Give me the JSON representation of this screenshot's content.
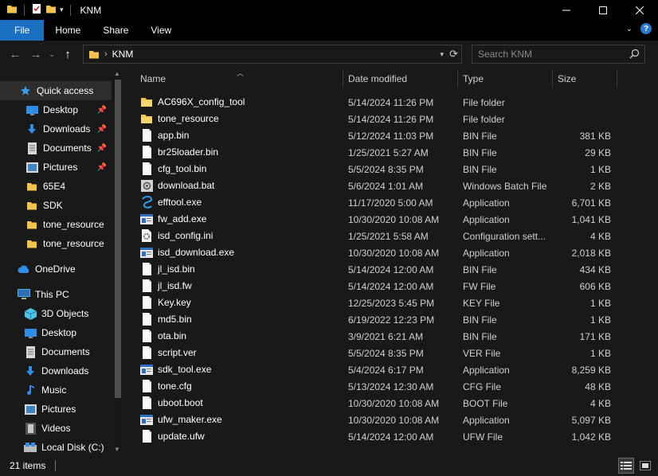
{
  "window": {
    "title": "KNM"
  },
  "ribbon": {
    "tabs": [
      "File",
      "Home",
      "Share",
      "View"
    ]
  },
  "address": {
    "crumbs": [
      "KNM"
    ]
  },
  "search": {
    "placeholder": "Search KNM"
  },
  "sidebar": {
    "items": [
      {
        "label": "Quick access",
        "icon": "star-icon"
      },
      {
        "label": "Desktop",
        "icon": "desktop-icon",
        "pinned": true
      },
      {
        "label": "Downloads",
        "icon": "download-icon",
        "pinned": true
      },
      {
        "label": "Documents",
        "icon": "documents-icon",
        "pinned": true
      },
      {
        "label": "Pictures",
        "icon": "pictures-icon",
        "pinned": true
      },
      {
        "label": "65E4",
        "icon": "folder-icon"
      },
      {
        "label": "SDK",
        "icon": "folder-icon"
      },
      {
        "label": "tone_resource",
        "icon": "folder-icon"
      },
      {
        "label": "tone_resource",
        "icon": "folder-icon"
      },
      {
        "label": "OneDrive",
        "icon": "cloud-icon"
      },
      {
        "label": "This PC",
        "icon": "pc-icon"
      },
      {
        "label": "3D Objects",
        "icon": "cube-icon"
      },
      {
        "label": "Desktop",
        "icon": "desktop-icon"
      },
      {
        "label": "Documents",
        "icon": "documents-icon"
      },
      {
        "label": "Downloads",
        "icon": "download-icon"
      },
      {
        "label": "Music",
        "icon": "music-icon"
      },
      {
        "label": "Pictures",
        "icon": "pictures-icon"
      },
      {
        "label": "Videos",
        "icon": "videos-icon"
      },
      {
        "label": "Local Disk (C:)",
        "icon": "disk-icon"
      }
    ]
  },
  "columns": {
    "name": "Name",
    "date": "Date modified",
    "type": "Type",
    "size": "Size"
  },
  "files": [
    {
      "name": "AC696X_config_tool",
      "date": "5/14/2024 11:26 PM",
      "type": "File folder",
      "size": "",
      "icon": "folder-icon"
    },
    {
      "name": "tone_resource",
      "date": "5/14/2024 11:26 PM",
      "type": "File folder",
      "size": "",
      "icon": "folder-icon"
    },
    {
      "name": "app.bin",
      "date": "5/12/2024 11:03 PM",
      "type": "BIN File",
      "size": "381 KB",
      "icon": "file-icon"
    },
    {
      "name": "br25loader.bin",
      "date": "1/25/2021 5:27 AM",
      "type": "BIN File",
      "size": "29 KB",
      "icon": "file-icon"
    },
    {
      "name": "cfg_tool.bin",
      "date": "5/5/2024 8:35 PM",
      "type": "BIN File",
      "size": "1 KB",
      "icon": "file-icon"
    },
    {
      "name": "download.bat",
      "date": "5/6/2024 1:01 AM",
      "type": "Windows Batch File",
      "size": "2 KB",
      "icon": "batch-icon"
    },
    {
      "name": "efftool.exe",
      "date": "11/17/2020 5:00 AM",
      "type": "Application",
      "size": "6,701 KB",
      "icon": "efftool-icon"
    },
    {
      "name": "fw_add.exe",
      "date": "10/30/2020 10:08 AM",
      "type": "Application",
      "size": "1,041 KB",
      "icon": "app-icon"
    },
    {
      "name": "isd_config.ini",
      "date": "1/25/2021 5:58 AM",
      "type": "Configuration sett...",
      "size": "4 KB",
      "icon": "config-icon"
    },
    {
      "name": "isd_download.exe",
      "date": "10/30/2020 10:08 AM",
      "type": "Application",
      "size": "2,018 KB",
      "icon": "app-icon"
    },
    {
      "name": "jl_isd.bin",
      "date": "5/14/2024 12:00 AM",
      "type": "BIN File",
      "size": "434 KB",
      "icon": "file-icon"
    },
    {
      "name": "jl_isd.fw",
      "date": "5/14/2024 12:00 AM",
      "type": "FW File",
      "size": "606 KB",
      "icon": "file-icon"
    },
    {
      "name": "Key.key",
      "date": "12/25/2023 5:45 PM",
      "type": "KEY File",
      "size": "1 KB",
      "icon": "file-icon"
    },
    {
      "name": "md5.bin",
      "date": "6/19/2022 12:23 PM",
      "type": "BIN File",
      "size": "1 KB",
      "icon": "file-icon"
    },
    {
      "name": "ota.bin",
      "date": "3/9/2021 6:21 AM",
      "type": "BIN File",
      "size": "171 KB",
      "icon": "file-icon"
    },
    {
      "name": "script.ver",
      "date": "5/5/2024 8:35 PM",
      "type": "VER File",
      "size": "1 KB",
      "icon": "file-icon"
    },
    {
      "name": "sdk_tool.exe",
      "date": "5/4/2024 6:17 PM",
      "type": "Application",
      "size": "8,259 KB",
      "icon": "app-icon"
    },
    {
      "name": "tone.cfg",
      "date": "5/13/2024 12:30 AM",
      "type": "CFG File",
      "size": "48 KB",
      "icon": "file-icon"
    },
    {
      "name": "uboot.boot",
      "date": "10/30/2020 10:08 AM",
      "type": "BOOT File",
      "size": "4 KB",
      "icon": "file-icon"
    },
    {
      "name": "ufw_maker.exe",
      "date": "10/30/2020 10:08 AM",
      "type": "Application",
      "size": "5,097 KB",
      "icon": "app-icon"
    },
    {
      "name": "update.ufw",
      "date": "5/14/2024 12:00 AM",
      "type": "UFW File",
      "size": "1,042 KB",
      "icon": "file-icon"
    }
  ],
  "status": {
    "count": "21 items"
  },
  "colors": {
    "accent": "#1a6fc1",
    "folder": "#f3c34b",
    "background": "#191919"
  }
}
